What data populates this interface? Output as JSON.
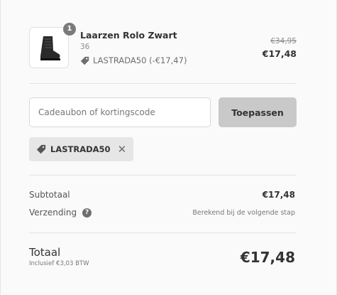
{
  "product": {
    "name": "Laarzen Rolo Zwart",
    "variant": "36",
    "quantity": "1",
    "discount_line": "LASTRADA50 (-€17,47)",
    "price_old": "€34,95",
    "price_new": "€17,48",
    "image": "boot-image"
  },
  "discount": {
    "placeholder": "Cadeaubon of kortingscode",
    "value": "",
    "apply_label": "Toepassen",
    "applied_code": "LASTRADA50"
  },
  "summary": {
    "subtotal_label": "Subtotaal",
    "subtotal_value": "€17,48",
    "shipping_label": "Verzending",
    "shipping_note": "Berekend bij de volgende stap",
    "total_label": "Totaal",
    "tax_note": "Inclusief €3,03 BTW",
    "currency": "EUR",
    "total_value": "€17,48"
  },
  "colors": {
    "button_bg": "#c9c9c9",
    "tag_bg": "#e6e6e6",
    "badge_bg": "#7a7a7a",
    "text": "#333333"
  }
}
